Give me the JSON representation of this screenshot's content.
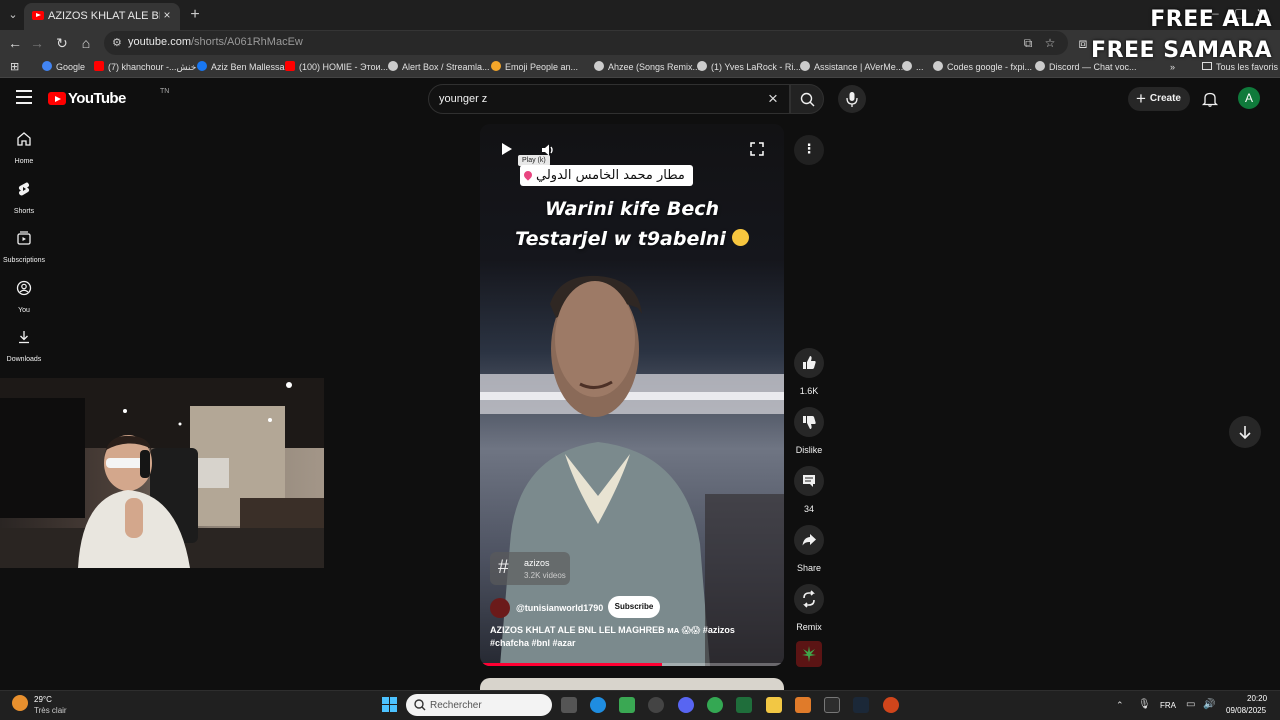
{
  "browser": {
    "tab_title": "AZIZOS KHLAT ALE BNL LEL MAGHREB",
    "url_host": "youtube.com",
    "url_path": "/shorts/A061RhMacEw",
    "bookmarks": [
      {
        "label": "Google",
        "color": "#4285f4"
      },
      {
        "label": "(7) khanchour -...خنش",
        "color": "#ff0000"
      },
      {
        "label": "Aziz Ben Mallessa",
        "color": "#1877f2"
      },
      {
        "label": "(100) HOMIE - Этои...",
        "color": "#ff0000"
      },
      {
        "label": "Alert Box / Streamla...",
        "color": "#dddddd"
      },
      {
        "label": "Emoji People an...",
        "color": "#f4a62a"
      },
      {
        "label": "Ahzee (Songs Remix...",
        "color": "#dddddd"
      },
      {
        "label": "(1) Yves LaRock - Ri...",
        "color": "#dddddd"
      },
      {
        "label": "Assistance | AVerMe...",
        "color": "#dddddd"
      },
      {
        "label": "...",
        "color": "#dddddd"
      },
      {
        "label": "Codes google - fxpi...",
        "color": "#dddddd"
      },
      {
        "label": "Discord — Chat voc...",
        "color": "#dddddd"
      }
    ],
    "favorites_label": "Tous les favoris"
  },
  "overlay": {
    "line1": "FREE ALA",
    "line2": "FREE SAMARA"
  },
  "header": {
    "logo_text": "YouTube",
    "region": "TN",
    "search_query": "younger z",
    "create_label": "Create",
    "avatar_letter": "A"
  },
  "guide": {
    "items": [
      {
        "label": "Home"
      },
      {
        "label": "Shorts"
      },
      {
        "label": "Subscriptions"
      },
      {
        "label": "You"
      },
      {
        "label": "Downloads"
      }
    ]
  },
  "short": {
    "caption_arabic": "مطار محمد الخامس الدولي",
    "caption_line1": "Warini kife Bech",
    "caption_line2": "Testarjel w t9abelni",
    "play_tooltip": "Play (k)",
    "hashtag": "azizos",
    "hashtag_count": "3.2K videos",
    "channel": "@tunisianworld1790",
    "subscribe_label": "Subscribe",
    "title": "AZIZOS KHLAT ALE BNL LEL MAGHREB ᴍᴀ 😱😱 #azizos #chafcha #bnl #azar",
    "progress_fraction": 0.6
  },
  "actions": {
    "like_count": "1.6K",
    "dislike_label": "Dislike",
    "comment_count": "34",
    "share_label": "Share",
    "remix_label": "Remix"
  },
  "taskbar": {
    "temperature": "29°C",
    "weather": "Très clair",
    "search_placeholder": "Rechercher",
    "language": "FRA",
    "time": "20:20",
    "date": "09/08/2025"
  }
}
